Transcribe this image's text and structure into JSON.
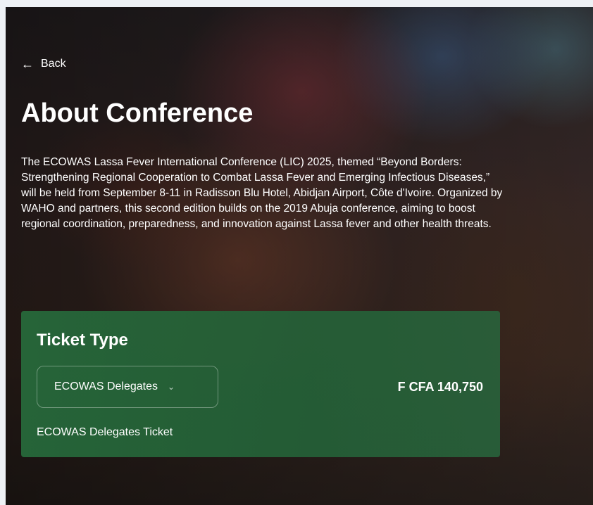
{
  "nav": {
    "back_label": "Back",
    "back_icon": "←"
  },
  "page": {
    "title": "About Conference",
    "description": "The ECOWAS Lassa Fever International Conference (LIC) 2025, themed “Beyond Borders: Strengthening Regional Cooperation to Combat Lassa Fever and Emerging Infectious Diseases,” will be held from September 8-11 in Radisson Blu Hotel, Abidjan Airport, Côte d'Ivoire. Organized by WAHO and partners, this second edition builds on the 2019 Abuja conference, aiming to boost regional coordination, preparedness, and innovation against Lassa fever and other health threats."
  },
  "ticket": {
    "heading": "Ticket Type",
    "selected_option": "ECOWAS Delegates",
    "chevron_icon": "⌄",
    "price": "F CFA 140,750",
    "description": "ECOWAS Delegates Ticket"
  },
  "colors": {
    "card_green": "#26683a",
    "text": "#ffffff"
  }
}
